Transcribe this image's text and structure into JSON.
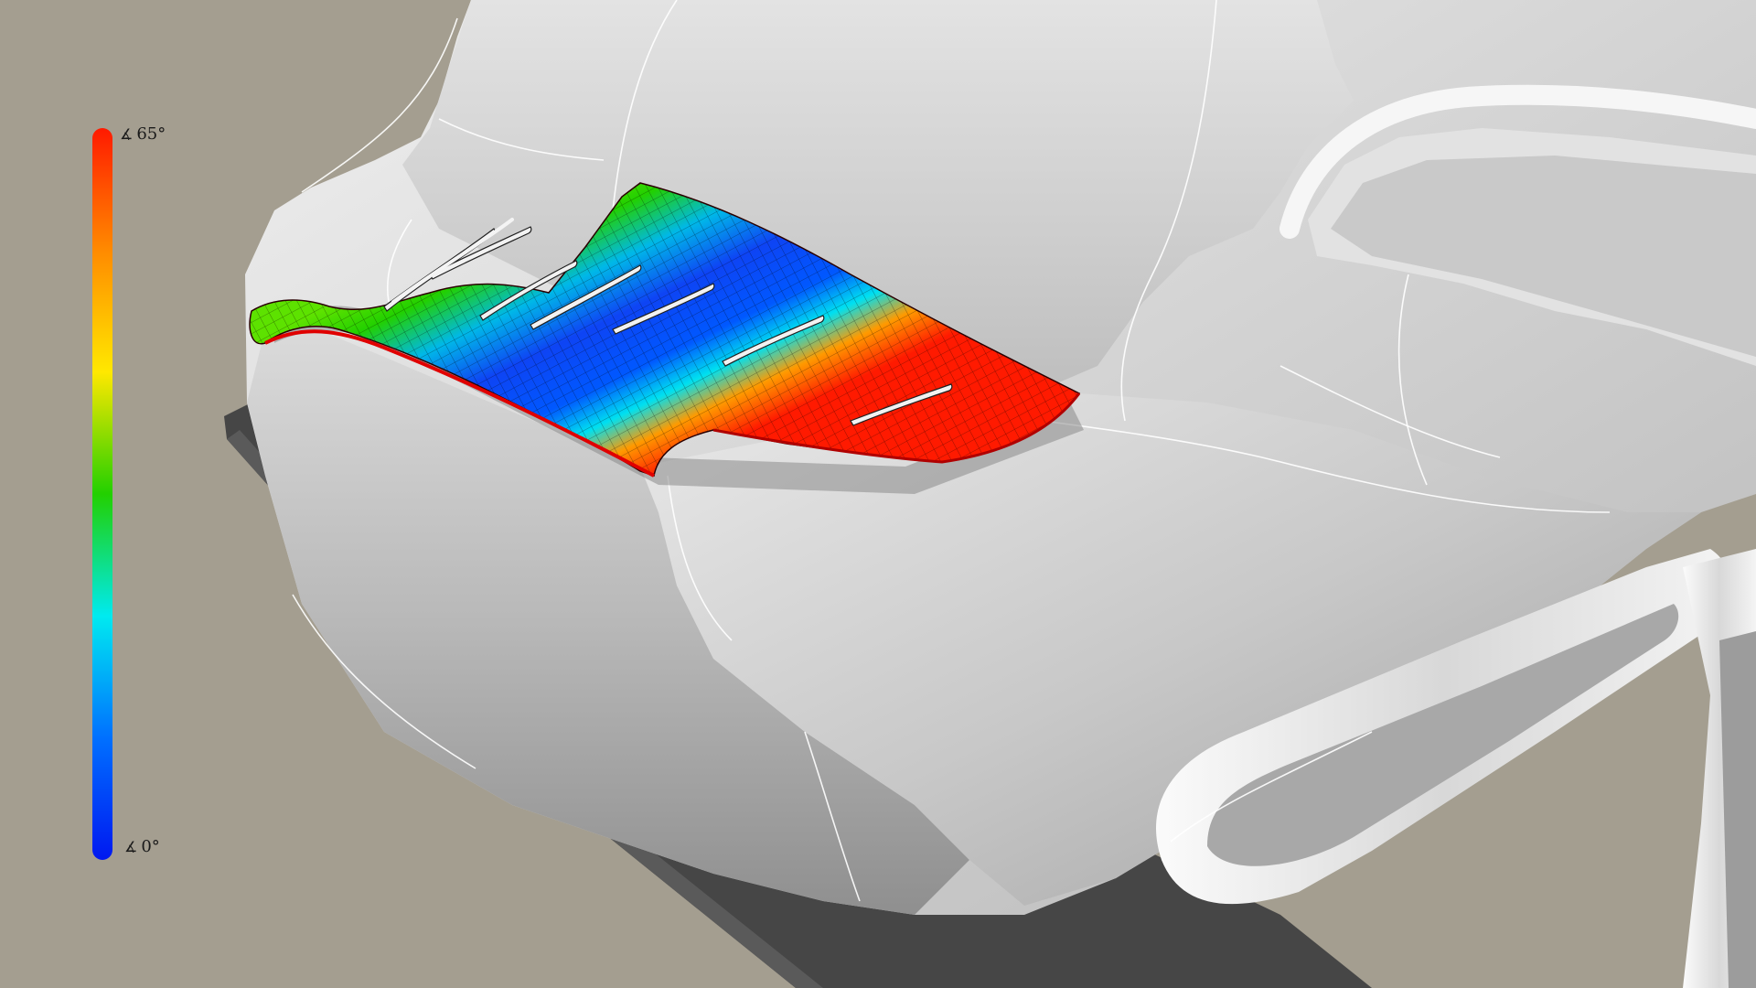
{
  "legend": {
    "title": "",
    "max_label": "65°",
    "min_label": "0°",
    "range": [
      0,
      65
    ],
    "unit": "°",
    "icon": "angle-icon",
    "colors": [
      "#ff1a00",
      "#ff8a00",
      "#ffe800",
      "#22d000",
      "#00eaf0",
      "#0070ff",
      "#0018f0"
    ]
  },
  "scene": {
    "background_color": "#a49e90",
    "model_color": "#d4d4d4",
    "shadow_color": "#464646"
  }
}
